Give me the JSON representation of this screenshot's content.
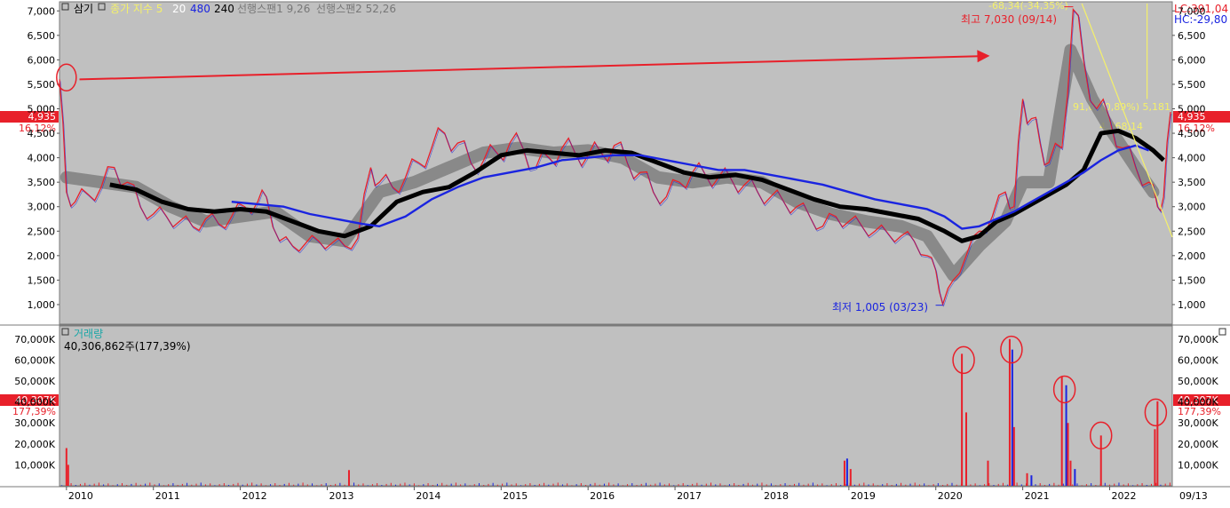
{
  "stock_name": "삼기",
  "chart_data": [
    {
      "type": "line",
      "panel": "price",
      "legend": {
        "indicator_label": "종가 지수 5",
        "ma_20": "20",
        "ma_480": "480",
        "ma_240": "240",
        "span1": "선행스팬1 9,26",
        "span2": "선행스팬2 52,26"
      },
      "y_ticks": [
        "7,000",
        "6,500",
        "6,000",
        "5,500",
        "5,000",
        "4,500",
        "4,000",
        "3,500",
        "3,000",
        "2,500",
        "2,000",
        "1,500",
        "1,000"
      ],
      "y_tick_values": [
        7000,
        6500,
        6000,
        5500,
        5000,
        4500,
        4000,
        3500,
        3000,
        2500,
        2000,
        1500,
        1000
      ],
      "ylim": [
        600,
        7150
      ],
      "x_ticks": [
        "2010",
        "2011",
        "2012",
        "2013",
        "2014",
        "2015",
        "2016",
        "2017",
        "2018",
        "2019",
        "2020",
        "2021",
        "2022"
      ],
      "x_tick_values": [
        2010,
        2011,
        2012,
        2013,
        2014,
        2015,
        2016,
        2017,
        2018,
        2019,
        2020,
        2021,
        2022
      ],
      "xlim": [
        2009.92,
        2022.72
      ],
      "x_end_label": "09/13",
      "current_price": "4,935",
      "current_change_pct": "16,12%",
      "current_value": 4935,
      "lc_label": "LC:391,04",
      "hc_label": "HC:-29,80",
      "high_label": "최고 7,030 (09/14)",
      "high_point": [
        2021.58,
        7030
      ],
      "low_label": "최저 1,005 (03/23)",
      "low_point": [
        2020.08,
        1005
      ],
      "fib_label_top": "-68,34(-34,35%)",
      "fib_label_mid": "91,00(0,89%) 5,181",
      "fib_label_val": "4,768,14",
      "series": [
        {
          "role": "price",
          "color": "#e8202a",
          "x": [
            2009.92,
            2010.0,
            2010.1,
            2010.25,
            2010.4,
            2010.55,
            2010.7,
            2010.85,
            2011.0,
            2011.15,
            2011.3,
            2011.45,
            2011.6,
            2011.75,
            2011.9,
            2012.05,
            2012.2,
            2012.3,
            2012.45,
            2012.6,
            2012.75,
            2012.9,
            2013.05,
            2013.2,
            2013.35,
            2013.5,
            2013.6,
            2013.75,
            2013.9,
            2014.05,
            2014.2,
            2014.35,
            2014.5,
            2014.65,
            2014.8,
            2014.95,
            2015.1,
            2015.25,
            2015.4,
            2015.55,
            2015.7,
            2015.85,
            2016.0,
            2016.15,
            2016.3,
            2016.45,
            2016.6,
            2016.75,
            2016.9,
            2017.05,
            2017.2,
            2017.35,
            2017.5,
            2017.65,
            2017.8,
            2017.95,
            2018.1,
            2018.25,
            2018.4,
            2018.55,
            2018.7,
            2018.85,
            2019.0,
            2019.15,
            2019.3,
            2019.45,
            2019.6,
            2019.75,
            2019.9,
            2020.0,
            2020.08,
            2020.2,
            2020.35,
            2020.5,
            2020.65,
            2020.8,
            2020.9,
            2021.0,
            2021.1,
            2021.2,
            2021.3,
            2021.45,
            2021.58,
            2021.7,
            2021.85,
            2022.0,
            2022.15,
            2022.3,
            2022.45,
            2022.55,
            2022.62,
            2022.7
          ],
          "values": [
            5600,
            3300,
            3100,
            3250,
            3400,
            3800,
            3500,
            3000,
            2850,
            2800,
            2700,
            2600,
            2750,
            2650,
            2800,
            3000,
            3100,
            3200,
            2300,
            2200,
            2250,
            2300,
            2250,
            2200,
            2350,
            3800,
            3500,
            3400,
            3600,
            3900,
            4200,
            4500,
            4300,
            3900,
            3950,
            4100,
            4300,
            4200,
            3800,
            4000,
            4200,
            4100,
            4050,
            4100,
            4250,
            3900,
            3700,
            3300,
            3200,
            3500,
            3700,
            3650,
            3600,
            3550,
            3450,
            3300,
            3200,
            3100,
            3000,
            2800,
            2600,
            2800,
            2700,
            2600,
            2500,
            2450,
            2400,
            2300,
            2000,
            1700,
            1005,
            1500,
            2000,
            2500,
            2800,
            3300,
            3000,
            5200,
            4800,
            4300,
            3900,
            4200,
            7030,
            6000,
            5000,
            4800,
            4200,
            3800,
            3500,
            3000,
            3200,
            4935
          ]
        },
        {
          "role": "ma-black",
          "color": "#000000",
          "x": [
            2010.5,
            2010.8,
            2011.1,
            2011.4,
            2011.7,
            2012.0,
            2012.3,
            2012.6,
            2012.9,
            2013.2,
            2013.5,
            2013.8,
            2014.1,
            2014.4,
            2014.7,
            2015.0,
            2015.3,
            2015.6,
            2015.9,
            2016.2,
            2016.5,
            2016.8,
            2017.1,
            2017.4,
            2017.7,
            2018.0,
            2018.3,
            2018.6,
            2018.9,
            2019.2,
            2019.5,
            2019.8,
            2020.1,
            2020.3,
            2020.5,
            2020.7,
            2020.9,
            2021.1,
            2021.3,
            2021.5,
            2021.7,
            2021.9,
            2022.1,
            2022.3,
            2022.5,
            2022.62
          ],
          "values": [
            3450,
            3350,
            3100,
            2950,
            2900,
            2950,
            2900,
            2700,
            2500,
            2400,
            2600,
            3100,
            3300,
            3400,
            3700,
            4050,
            4150,
            4100,
            4050,
            4150,
            4100,
            3900,
            3700,
            3600,
            3650,
            3550,
            3350,
            3150,
            3000,
            2950,
            2850,
            2750,
            2500,
            2300,
            2400,
            2700,
            2850,
            3050,
            3250,
            3450,
            3750,
            4500,
            4550,
            4400,
            4150,
            3950
          ]
        },
        {
          "role": "ma-blue",
          "color": "#1a24e0",
          "x": [
            2011.9,
            2012.2,
            2012.5,
            2012.8,
            2013.1,
            2013.4,
            2013.6,
            2013.9,
            2014.2,
            2014.5,
            2014.8,
            2015.1,
            2015.4,
            2015.7,
            2016.0,
            2016.3,
            2016.6,
            2016.9,
            2017.2,
            2017.5,
            2017.8,
            2018.1,
            2018.4,
            2018.7,
            2019.0,
            2019.3,
            2019.6,
            2019.9,
            2020.1,
            2020.3,
            2020.5,
            2020.7,
            2020.9,
            2021.1,
            2021.3,
            2021.5,
            2021.7,
            2021.9,
            2022.1,
            2022.3,
            2022.45
          ],
          "values": [
            3100,
            3050,
            3000,
            2850,
            2750,
            2650,
            2600,
            2800,
            3150,
            3400,
            3600,
            3700,
            3800,
            3950,
            4000,
            4050,
            4050,
            3950,
            3850,
            3750,
            3750,
            3650,
            3550,
            3450,
            3300,
            3150,
            3050,
            2950,
            2800,
            2550,
            2600,
            2750,
            2900,
            3100,
            3300,
            3500,
            3700,
            3950,
            4150,
            4250,
            4150
          ]
        },
        {
          "role": "cloud-band",
          "color": "#7a7a7a",
          "x": [
            2010.0,
            2010.4,
            2010.8,
            2011.2,
            2011.6,
            2012.0,
            2012.4,
            2012.8,
            2013.2,
            2013.6,
            2014.0,
            2014.4,
            2014.8,
            2015.2,
            2015.6,
            2016.0,
            2016.4,
            2016.8,
            2017.2,
            2017.6,
            2018.0,
            2018.4,
            2018.8,
            2019.2,
            2019.6,
            2019.9,
            2020.2,
            2020.5,
            2020.8,
            2021.0,
            2021.3,
            2021.55,
            2021.8,
            2022.0,
            2022.3,
            2022.5
          ],
          "values": [
            3600,
            3500,
            3400,
            3000,
            2700,
            2800,
            2900,
            2400,
            2300,
            3300,
            3500,
            3800,
            4100,
            4200,
            4100,
            4150,
            4000,
            3600,
            3500,
            3600,
            3500,
            3100,
            2850,
            2700,
            2600,
            2400,
            1600,
            2200,
            2700,
            3500,
            3500,
            6200,
            5200,
            4600,
            3800,
            3300
          ]
        }
      ],
      "annotations": [
        {
          "type": "arrow",
          "from": [
            2010.15,
            5600
          ],
          "to": [
            2020.6,
            6080
          ],
          "color": "#e8202a"
        },
        {
          "type": "circle",
          "at": [
            2010.0,
            5640
          ],
          "color": "#e8202a"
        }
      ]
    },
    {
      "type": "bar",
      "panel": "volume",
      "title": "거래량",
      "value_label": "40,306,862주(177,39%)",
      "current_value": "40,307K",
      "current_change_pct": "177,39%",
      "y_ticks": [
        "70,000K",
        "60,000K",
        "50,000K",
        "40,000K",
        "30,000K",
        "20,000K",
        "10,000K"
      ],
      "y_tick_values": [
        70000,
        60000,
        50000,
        40000,
        30000,
        20000,
        10000
      ],
      "ylim": [
        0,
        75000
      ],
      "xlim": [
        2009.92,
        2022.72
      ],
      "x": [
        2010.0,
        2010.02,
        2013.25,
        2018.95,
        2018.98,
        2019.02,
        2020.3,
        2020.35,
        2020.6,
        2020.85,
        2020.88,
        2020.9,
        2021.05,
        2021.1,
        2021.45,
        2021.5,
        2021.52,
        2021.55,
        2021.6,
        2021.9,
        2022.52,
        2022.55
      ],
      "values": [
        18000,
        10000,
        7500,
        12000,
        13000,
        8000,
        63000,
        35000,
        12000,
        70000,
        65000,
        28000,
        6000,
        5000,
        52000,
        48000,
        30000,
        12000,
        8000,
        24000,
        27000,
        40307
      ],
      "colors": [
        "#e8202a",
        "#e8202a",
        "#e8202a",
        "#e8202a",
        "#1a24e0",
        "#e8202a",
        "#e8202a",
        "#e8202a",
        "#e8202a",
        "#e8202a",
        "#1a24e0",
        "#e8202a",
        "#e8202a",
        "#1a24e0",
        "#e8202a",
        "#1a24e0",
        "#e8202a",
        "#e8202a",
        "#1a24e0",
        "#e8202a",
        "#e8202a",
        "#e8202a"
      ],
      "annotations": [
        {
          "type": "circle",
          "at": [
            2020.32,
            60000
          ],
          "color": "#e8202a"
        },
        {
          "type": "circle",
          "at": [
            2020.87,
            65000
          ],
          "color": "#e8202a"
        },
        {
          "type": "circle",
          "at": [
            2021.48,
            46000
          ],
          "color": "#e8202a"
        },
        {
          "type": "circle",
          "at": [
            2021.9,
            24000
          ],
          "color": "#e8202a"
        },
        {
          "type": "circle",
          "at": [
            2022.53,
            35000
          ],
          "color": "#e8202a"
        }
      ]
    }
  ]
}
